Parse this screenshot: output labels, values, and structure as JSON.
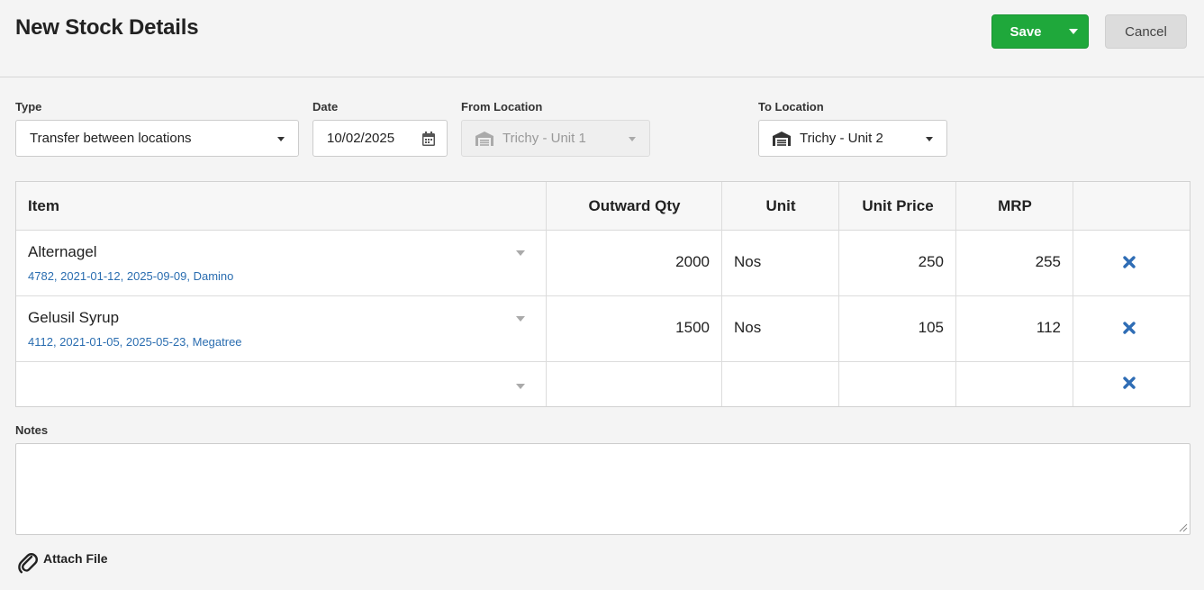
{
  "header": {
    "title": "New Stock Details",
    "save_label": "Save",
    "cancel_label": "Cancel"
  },
  "form": {
    "type": {
      "label": "Type",
      "value": "Transfer between locations"
    },
    "date": {
      "label": "Date",
      "value": "10/02/2025"
    },
    "from_location": {
      "label": "From Location",
      "value": "Trichy - Unit 1"
    },
    "to_location": {
      "label": "To Location",
      "value": "Trichy - Unit 2"
    }
  },
  "table": {
    "columns": {
      "item": "Item",
      "outward_qty": "Outward Qty",
      "unit": "Unit",
      "unit_price": "Unit Price",
      "mrp": "MRP"
    },
    "rows": [
      {
        "item": "Alternagel",
        "meta": "4782, 2021-01-12, 2025-09-09, Damino",
        "outward_qty": "2000",
        "unit": "Nos",
        "unit_price": "250",
        "mrp": "255"
      },
      {
        "item": "Gelusil Syrup",
        "meta": "4112, 2021-01-05, 2025-05-23, Megatree",
        "outward_qty": "1500",
        "unit": "Nos",
        "unit_price": "105",
        "mrp": "112"
      }
    ]
  },
  "notes": {
    "label": "Notes",
    "value": ""
  },
  "attach": {
    "label": "Attach File"
  },
  "colors": {
    "save": "#1fa83b",
    "link_meta": "#2a6db0",
    "remove_icon": "#2f6db5"
  },
  "icons": {
    "calendar": "calendar-icon",
    "warehouse": "warehouse-icon",
    "remove": "remove-row-icon",
    "attach": "paperclip-icon"
  }
}
